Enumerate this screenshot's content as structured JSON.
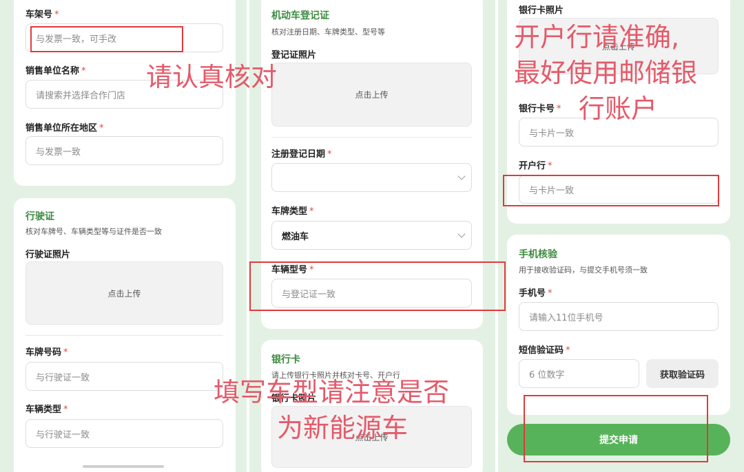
{
  "p1": {
    "frame_label": "车架号",
    "frame_placeholder": "与发票一致，可手改",
    "seller_name_label": "销售单位名称",
    "seller_name_placeholder": "请搜索并选择合作门店",
    "seller_region_label": "销售单位所在地区",
    "seller_region_placeholder": "与发票一致",
    "license_title": "行驶证",
    "license_subtitle": "核对车牌号、车辆类型等与证件是否一致",
    "license_photo_label": "行驶证照片",
    "upload_text": "点击上传",
    "plate_label": "车牌号码",
    "plate_placeholder": "与行驶证一致",
    "vehicle_type_label": "车辆类型",
    "vehicle_type_placeholder": "与行驶证一致"
  },
  "p2": {
    "reg_title": "机动车登记证",
    "reg_subtitle": "核对注册日期、车牌类型、型号等",
    "reg_photo_label": "登记证照片",
    "upload_text": "点击上传",
    "reg_date_label": "注册登记日期",
    "plate_type_label": "车牌类型",
    "plate_type_value": "燃油车",
    "model_label": "车辆型号",
    "model_placeholder": "与登记证一致",
    "bank_title": "银行卡",
    "bank_subtitle": "请上传银行卡照片并核对卡号、开户行",
    "bank_photo_label": "银行卡照片",
    "bank_upload_text": "点击上传"
  },
  "p3": {
    "bank_photo_label": "银行卡照片",
    "upload_text": "点击上传",
    "card_no_label": "银行卡号",
    "card_no_placeholder": "与卡片一致",
    "bank_branch_label": "开户行",
    "bank_branch_placeholder": "与卡片一致",
    "phone_title": "手机核验",
    "phone_subtitle": "用于接收验证码，与提交手机号须一致",
    "phone_label": "手机号",
    "phone_placeholder": "请输入11位手机号",
    "sms_label": "短信验证码",
    "sms_placeholder": "6 位数字",
    "get_code_button": "获取验证码",
    "submit_button": "提交申请"
  },
  "annotations": {
    "note1": "请认真核对",
    "note2_line1": "开户行请准确,",
    "note2_line2": "最好使用邮储银",
    "note2_line3": "行账户",
    "note3_line1": "填写车型请注意是否",
    "note3_line2": "为新能源车"
  },
  "colors": {
    "panel_bg": "#e3f1e4",
    "accent_green": "#3a8a3f",
    "submit_green": "#57b35a",
    "required_star": "#e04848",
    "annotation_red": "#e45a6a",
    "highlight_box": "#e0393c"
  }
}
